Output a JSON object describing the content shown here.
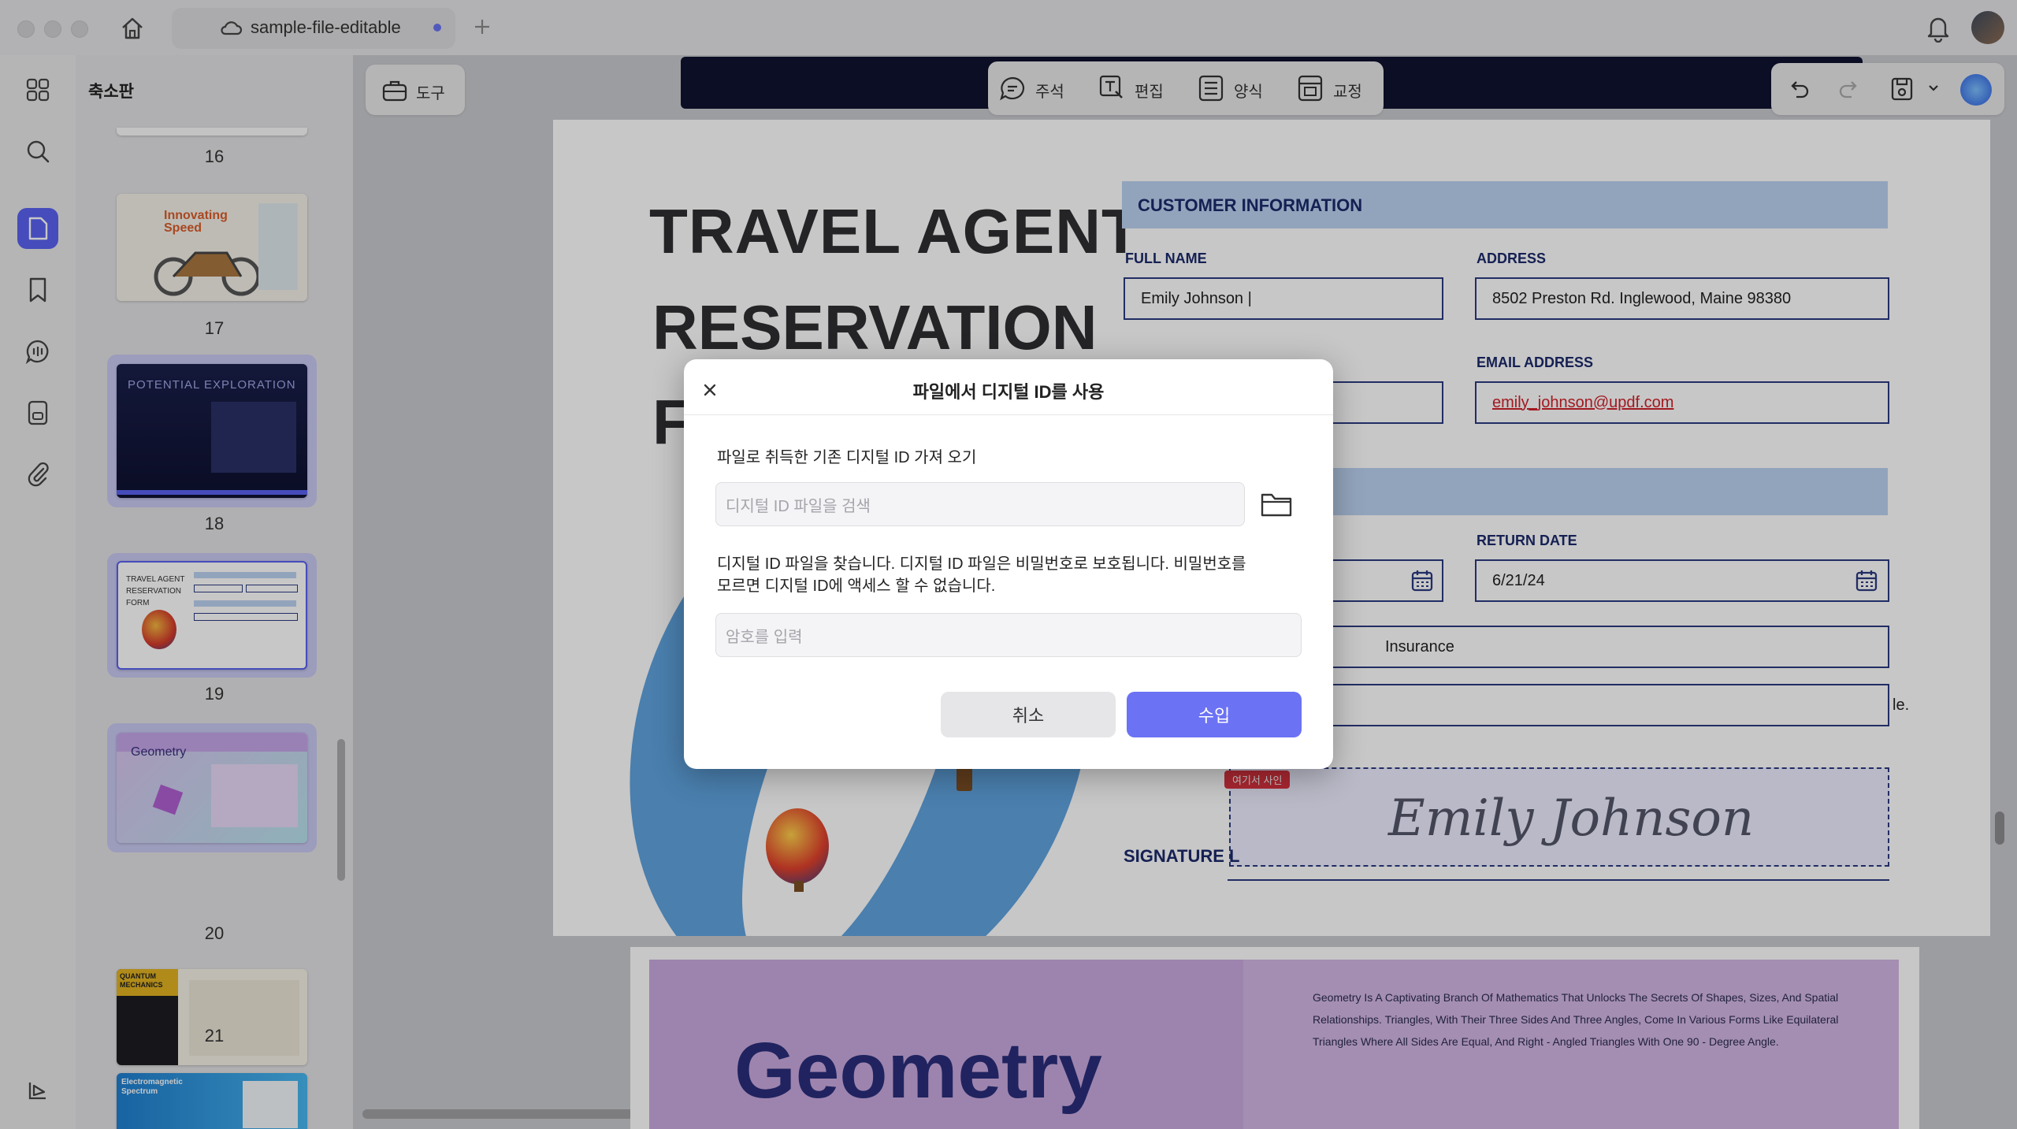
{
  "app": {
    "tab_title": "sample-file-editable",
    "panel_title": "축소판",
    "tools_label": "도구"
  },
  "toolbar": {
    "comment": "주석",
    "edit": "편집",
    "form": "양식",
    "review": "교정"
  },
  "thumbnails": [
    {
      "page": "16"
    },
    {
      "page": "17",
      "title": "Innovating Speed"
    },
    {
      "page": "18",
      "title": "POTENTIAL EXPLORATION"
    },
    {
      "page": "19",
      "title": "TRAVEL AGENT RESERVATION FORM"
    },
    {
      "page": "20",
      "title": "Geometry"
    },
    {
      "page": "21",
      "title": "QUANTUM MECHANICS"
    },
    {
      "title": "Electromagnetic Spectrum"
    }
  ],
  "document": {
    "title_line1": "TRAVEL AGENT",
    "title_line2": "RESERVATION",
    "title_line3": "F",
    "customer_info": "CUSTOMER INFORMATION",
    "full_name_label": "FULL NAME",
    "full_name": "Emily Johnson |",
    "address_label": "ADDRESS",
    "address": "8502 Preston Rd. Inglewood, Maine 98380",
    "email_label": "EMAIL ADDRESS",
    "email": "emily_johnson@updf.com",
    "return_date_label": "RETURN DATE",
    "return_date": "6/21/24",
    "insurance": "Insurance",
    "le": "le.",
    "sign_here": "여기서 사인",
    "signature_name": "Emily Johnson",
    "signature_label": "SIGNATURE L",
    "next_page_title": "Geometry",
    "next_page_text": "Geometry Is A Captivating Branch Of Mathematics That Unlocks The Secrets Of Shapes, Sizes, And Spatial Relationships. Triangles, With Their Three Sides And Three Angles, Come In Various Forms Like Equilateral Triangles Where All Sides Are Equal, And Right - Angled Triangles With One 90 - Degree Angle."
  },
  "dialog": {
    "title": "파일에서 디지털 ID를 사용",
    "import_label": "파일로 취득한 기존 디지털 ID 가져 오기",
    "file_placeholder": "디지털 ID 파일을 검색",
    "description_line1": "디지털 ID 파일을 찾습니다. 디지털 ID 파일은 비밀번호로 보호됩니다. 비밀번호를",
    "description_line2": "모르면 디지털 ID에 액세스 할 수 없습니다.",
    "password_placeholder": "암호를 입력",
    "cancel": "취소",
    "import": "수입"
  },
  "colors": {
    "accent": "#5a62f0",
    "navy": "#1b2a6b",
    "band": "#bcd2f1",
    "email_red": "#d0202a"
  }
}
